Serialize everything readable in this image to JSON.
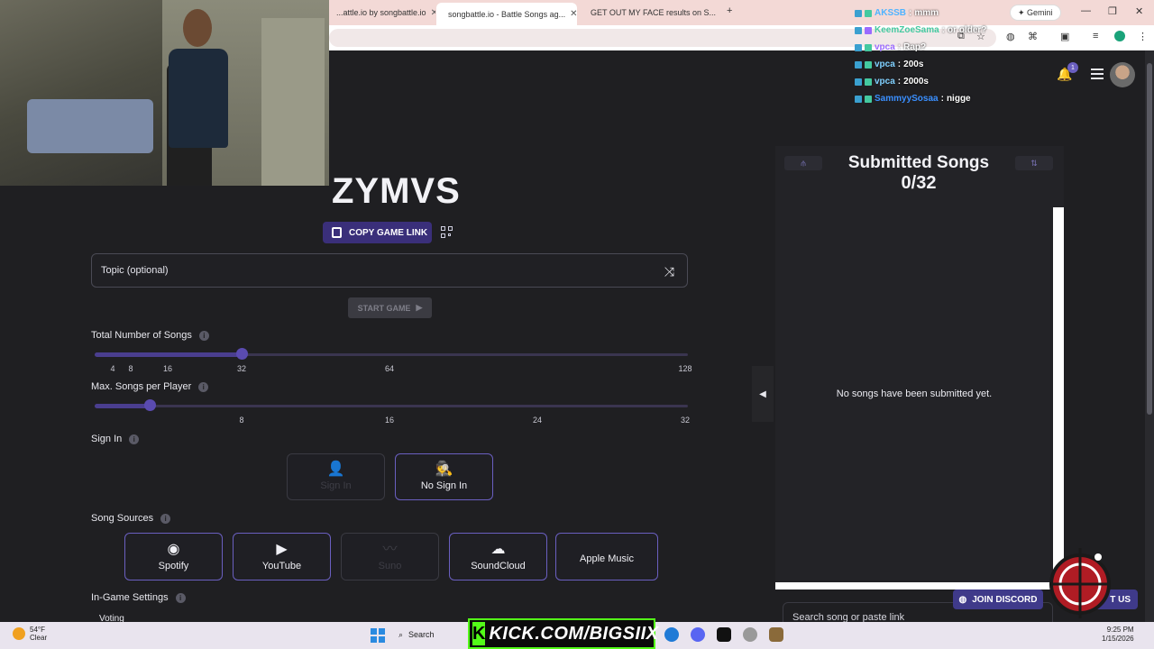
{
  "browser": {
    "tabs": [
      {
        "label": "...attle.io by songbattle.io",
        "active": false
      },
      {
        "label": "songbattle.io - Battle Songs ag...",
        "active": true
      },
      {
        "label": "GET OUT MY FACE results on S...",
        "active": false
      }
    ],
    "gemini_label": "Gemini"
  },
  "chat": [
    {
      "user": "AKSSB",
      "message": "mmm",
      "user_color": "#4fb3ff"
    },
    {
      "user": "KeemZoeSama",
      "message": "or older?",
      "user_color": "#44c9a0"
    },
    {
      "user": "vpca",
      "message": "Rap?",
      "user_color": "#9a6bff"
    },
    {
      "user": "vpca",
      "message": "200s",
      "user_color": "#7fd0ff"
    },
    {
      "user": "vpca",
      "message": "2000s",
      "user_color": "#7fd0ff"
    },
    {
      "user": "SammyySosaa",
      "message": "nigge",
      "user_color": "#3a8fff"
    }
  ],
  "header": {
    "notification_count": "1"
  },
  "game": {
    "title": "ZYMVS",
    "copy_link_label": "COPY GAME LINK",
    "topic_placeholder": "Topic (optional)",
    "start_label": "START GAME",
    "total_songs": {
      "label": "Total Number of Songs",
      "ticks": [
        "4",
        "8",
        "16",
        "32",
        "64",
        "128"
      ],
      "value": 32
    },
    "max_per_player": {
      "label": "Max. Songs per Player",
      "ticks": [
        "8",
        "16",
        "24",
        "32"
      ],
      "value": 4
    },
    "sign_in": {
      "label": "Sign In",
      "options": [
        {
          "label": "Sign In",
          "enabled": false
        },
        {
          "label": "No Sign In",
          "enabled": true
        }
      ]
    },
    "song_sources": {
      "label": "Song Sources",
      "options": [
        {
          "label": "Spotify",
          "enabled": true
        },
        {
          "label": "YouTube",
          "enabled": true
        },
        {
          "label": "Suno",
          "enabled": false
        },
        {
          "label": "SoundCloud",
          "enabled": true
        },
        {
          "label": "Apple Music",
          "enabled": true
        }
      ]
    },
    "in_game_settings_label": "In-Game Settings",
    "voting_label": "Voting"
  },
  "submitted": {
    "title": "Submitted Songs",
    "count": "0/32",
    "empty_message": "No songs have been submitted yet.",
    "search_placeholder": "Search song or paste link"
  },
  "footer": {
    "discord_label": "JOIN DISCORD",
    "contact_label": "T US"
  },
  "taskbar": {
    "weather_temp": "54°F",
    "weather_desc": "Clear",
    "search_label": "Search",
    "kick_text": "KICK.COM/BIGSIIX",
    "time": "9:25 PM",
    "date": "1/15/2026"
  }
}
